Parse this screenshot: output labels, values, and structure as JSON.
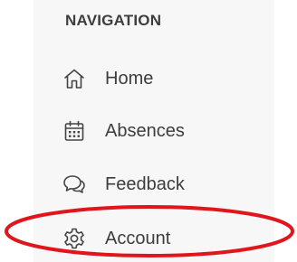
{
  "navigation": {
    "heading": "NAVIGATION",
    "items": [
      {
        "label": "Home",
        "icon": "home-icon"
      },
      {
        "label": "Absences",
        "icon": "calendar-icon"
      },
      {
        "label": "Feedback",
        "icon": "chat-icon"
      },
      {
        "label": "Account",
        "icon": "gear-icon"
      }
    ]
  },
  "highlight": {
    "color": "#e0161c",
    "target": "Account"
  }
}
